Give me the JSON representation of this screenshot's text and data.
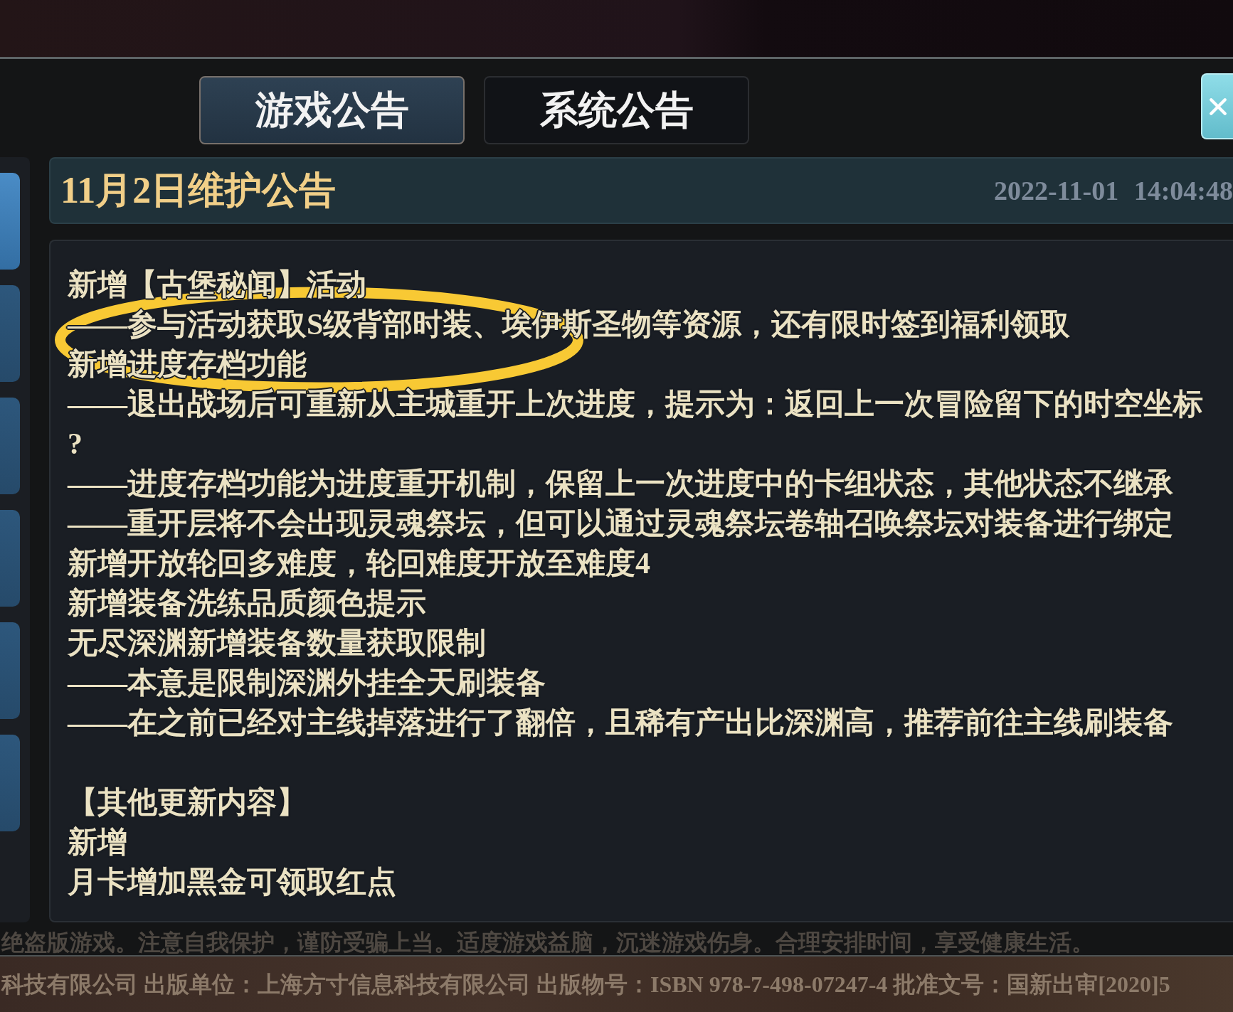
{
  "top_tabs": [
    {
      "label": "游戏公告",
      "selected": true
    },
    {
      "label": "系统公告",
      "selected": false
    }
  ],
  "sidebar": {
    "items": [
      {
        "selected": true
      },
      {
        "selected": false
      },
      {
        "selected": false
      },
      {
        "selected": false
      },
      {
        "selected": false
      },
      {
        "selected": false
      }
    ]
  },
  "announcement": {
    "title": "11月2日维护公告",
    "date": "2022-11-01 14:04:48",
    "sections": [
      {
        "lines": [
          "新增【古堡秘闻】活动",
          "——参与活动获取S级背部时装、埃伊斯圣物等资源，还有限时签到福利领取",
          "新增进度存档功能",
          "——退出战场后可重新从主城重开上次进度，提示为：返回上一次冒险留下的时空坐标",
          "?",
          "——进度存档功能为进度重开机制，保留上一次进度中的卡组状态，其他状态不继承",
          "——重开层将不会出现灵魂祭坛，但可以通过灵魂祭坛卷轴召唤祭坛对装备进行绑定",
          "新增开放轮回多难度，轮回难度开放至难度4",
          "新增装备洗练品质颜色提示",
          "无尽深渊新增装备数量获取限制",
          "——本意是限制深渊外挂全天刷装备",
          "——在之前已经对主线掉落进行了翻倍，且稀有产出比深渊高，推荐前往主线刷装备"
        ]
      },
      {
        "lines": [
          "【其他更新内容】",
          "新增",
          "月卡增加黑金可领取红点"
        ]
      }
    ]
  },
  "footer": {
    "notice": "绝盗版游戏。注意自我保护，谨防受骗上当。适度游戏益脑，沉迷游戏伤身。合理安排时间，享受健康生活。",
    "publisher_line": "科技有限公司 出版单位：上海方寸信息科技有限公司 出版物号：ISBN 978-7-498-07247-4 批准文号：国新出审[2020]5"
  }
}
